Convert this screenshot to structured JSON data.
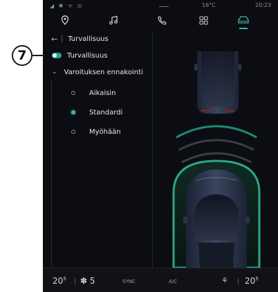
{
  "callout": {
    "number": "7"
  },
  "status_bar": {
    "temperature": "16°C",
    "time": "20:23"
  },
  "topnav": {
    "icons": [
      "location-pin-icon",
      "music-icon",
      "phone-icon",
      "apps-grid-icon",
      "car-icon"
    ],
    "active": "car-icon",
    "accent_color": "#3fb6a6"
  },
  "menu": {
    "title": "Turvallisuus",
    "toggle": {
      "label": "Turvallisuus",
      "state": "on"
    },
    "expand_item": {
      "label": "Varoituksen ennakointi"
    },
    "options": [
      {
        "label": "Aikaisin",
        "selected": false
      },
      {
        "label": "Standardi",
        "selected": true
      },
      {
        "label": "Myöhään",
        "selected": false
      }
    ]
  },
  "climate": {
    "left_temp": "20",
    "left_temp_fraction": "5",
    "fan_speed": "5",
    "sync_label": "SYNC",
    "ac_label": "A/C",
    "right_temp": "20",
    "right_temp_fraction": "5"
  }
}
